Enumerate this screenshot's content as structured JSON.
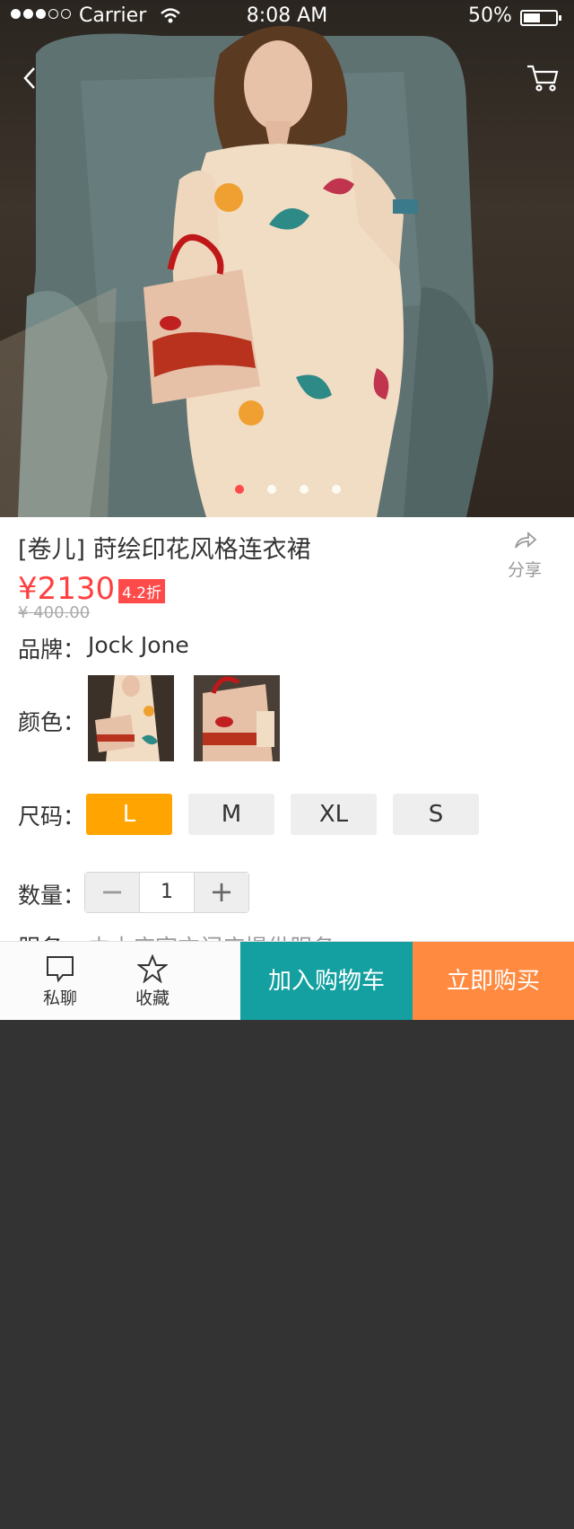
{
  "status_bar": {
    "carrier": "Carrier",
    "time": "8:08 AM",
    "battery": "50%"
  },
  "nav": {
    "back_icon": "chevron-left-icon",
    "cart_icon": "cart-icon"
  },
  "gallery": {
    "image_count": 4,
    "active_index": 0
  },
  "product": {
    "title": "[卷儿] 莳绘印花风格连衣裙",
    "price": "¥2130",
    "discount": "4.2折",
    "original_price": "¥ 400.00",
    "share_label": "分享"
  },
  "brand": {
    "label": "品牌：",
    "value": "Jock Jone"
  },
  "color": {
    "label": "颜色："
  },
  "size": {
    "label": "尺码：",
    "options": [
      "L",
      "M",
      "XL",
      "S"
    ],
    "selected": "L"
  },
  "quantity": {
    "label": "数量：",
    "minus": "−",
    "value": "1",
    "plus": "+"
  },
  "service": {
    "label": "服务：",
    "text": "由本店官方门店提供服务"
  },
  "bottom_bar": {
    "chat_label": "私聊",
    "favorite_label": "收藏",
    "add_to_cart": "加入购物车",
    "buy_now": "立即购买"
  },
  "colors": {
    "price_red": "#ff4040",
    "selected_size": "#ffa400",
    "add_cart_teal": "#14a0a0",
    "buy_now_orange": "#ff8a40"
  }
}
